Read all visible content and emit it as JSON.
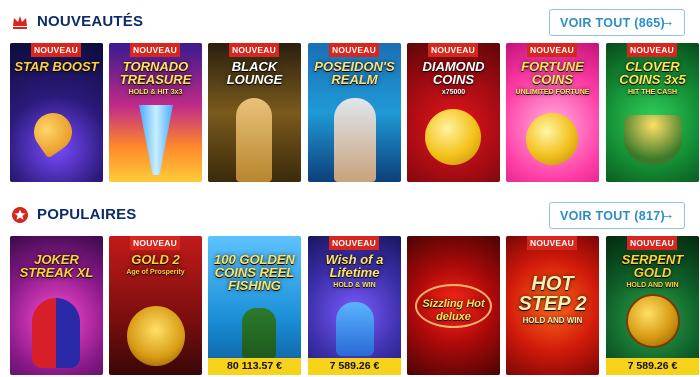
{
  "sections": [
    {
      "title": "NOUVEAUTÉS",
      "icon": "crown-icon",
      "see_all": "VOIR TOUT (865)",
      "games": [
        {
          "name": "STAR BOOST",
          "sub": "",
          "badge": "NOUVEAU",
          "jackpot": ""
        },
        {
          "name": "TORNADO TREASURE",
          "sub": "HOLD & HIT 3x3",
          "badge": "NOUVEAU",
          "jackpot": ""
        },
        {
          "name": "BLACK LOUNGE",
          "sub": "",
          "badge": "NOUVEAU",
          "jackpot": ""
        },
        {
          "name": "POSEIDON'S REALM",
          "sub": "",
          "badge": "NOUVEAU",
          "jackpot": ""
        },
        {
          "name": "DIAMOND COINS",
          "sub": "x75000",
          "badge": "NOUVEAU",
          "jackpot": ""
        },
        {
          "name": "FORTUNE COINS",
          "sub": "UNLIMITED FORTUNE",
          "badge": "NOUVEAU",
          "jackpot": ""
        },
        {
          "name": "CLOVER COINS 3x5",
          "sub": "HIT THE CASH",
          "badge": "NOUVEAU",
          "jackpot": ""
        }
      ]
    },
    {
      "title": "POPULAIRES",
      "icon": "star-badge-icon",
      "see_all": "VOIR TOUT (817)",
      "games": [
        {
          "name": "JOKER STREAK XL",
          "sub": "",
          "badge": "",
          "jackpot": ""
        },
        {
          "name": "GOLD 2",
          "sub": "Age of Prosperity",
          "badge": "NOUVEAU",
          "jackpot": ""
        },
        {
          "name": "100 GOLDEN COINS REEL FISHING",
          "sub": "",
          "badge": "",
          "jackpot": "80 113.57 €"
        },
        {
          "name": "Wish of a Lifetime",
          "sub": "HOLD & WIN",
          "badge": "NOUVEAU",
          "jackpot": "7 589.26 €"
        },
        {
          "name": "Sizzling Hot deluxe",
          "sub": "",
          "badge": "",
          "jackpot": ""
        },
        {
          "name": "HOT STEP 2",
          "sub": "HOLD AND WIN",
          "badge": "NOUVEAU",
          "jackpot": ""
        },
        {
          "name": "SERPENT GOLD",
          "sub": "HOLD AND WIN",
          "badge": "NOUVEAU",
          "jackpot": "7 589.26 €"
        }
      ]
    }
  ],
  "icons": {
    "arrow": "→"
  },
  "colors": {
    "title": "#0d2a6b",
    "link": "#2b8cc8",
    "badge": "#d7261d",
    "jackpot": "#f7d21b"
  }
}
